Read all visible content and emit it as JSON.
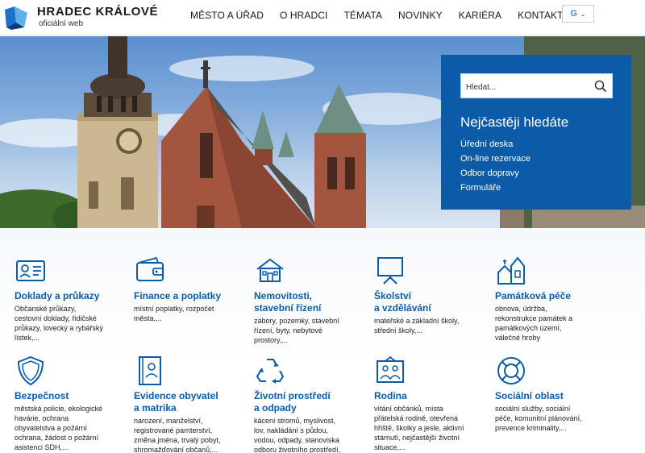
{
  "header": {
    "logo_title": "HRADEC KRÁLOVÉ",
    "logo_subtitle": "oficiální web",
    "nav": [
      "MĚSTO A ÚŘAD",
      "O HRADCI",
      "TÉMATA",
      "NOVINKY",
      "KARIÉRA",
      "KONTAKTY"
    ],
    "language_icon": "google-translate-icon"
  },
  "search": {
    "placeholder": "Hledat...",
    "heading": "Nejčastěji hledáte",
    "links": [
      "Úřední deska",
      "On-line rezervace",
      "Odbor dopravy",
      "Formuláře"
    ]
  },
  "tiles": [
    {
      "icon": "id-card-icon",
      "title_lines": [
        "Doklady a průkazy"
      ],
      "desc_lines": [
        "Občanské průkazy,",
        "cestovní doklady, řidičské",
        "průkazy, lovecký a rybářský",
        "lístek,..."
      ]
    },
    {
      "icon": "wallet-icon",
      "title_lines": [
        "Finance a poplatky"
      ],
      "desc_lines": [
        "místní poplatky, rozpočet",
        "města,..."
      ]
    },
    {
      "icon": "house-icon",
      "title_lines": [
        "Nemovitosti,",
        "stavební řízení"
      ],
      "desc_lines": [
        "zábory, pozemky, stavební",
        "řízení, byty, nebytové",
        "prostory,..."
      ]
    },
    {
      "icon": "chalkboard-icon",
      "title_lines": [
        "Školství",
        "a vzdělávání"
      ],
      "desc_lines": [
        "mateřské a základní školy,",
        "střední školy,..."
      ]
    },
    {
      "icon": "monument-icon",
      "title_lines": [
        "Památková péče"
      ],
      "desc_lines": [
        "obnova, údržba,",
        "rekonstrukce památek a",
        "památkových území,",
        "válečné hroby"
      ]
    },
    {
      "icon": "shield-icon",
      "title_lines": [
        "Bezpečnost"
      ],
      "desc_lines": [
        "městská policie, ekologické",
        "havárie, ochrana",
        "obyvatelstva a požární",
        "ochrana, žádost o požární",
        "asistenci SDH,..."
      ]
    },
    {
      "icon": "registry-book-icon",
      "title_lines": [
        "Evidence obyvatel",
        "a matrika"
      ],
      "desc_lines": [
        "narození, manželství,",
        "registrované parnterství,",
        "změna jména, trvalý pobyt,",
        "shromažďování občanů,..."
      ]
    },
    {
      "icon": "recycle-icon",
      "title_lines": [
        "Životní prostředí",
        "a odpady"
      ],
      "desc_lines": [
        "kácení stromů, myslivost,",
        "lov, nakládání s půdou,",
        "vodou, odpady, stanoviska",
        "odboru životního prostředí,"
      ]
    },
    {
      "icon": "family-icon",
      "title_lines": [
        "Rodina"
      ],
      "desc_lines": [
        "vítání občánků, místa",
        "přátelská rodině, otevřená",
        "hřiště, školky a jesle, aktivní",
        "stárnutí, nejčastější životní",
        "situace,..."
      ]
    },
    {
      "icon": "lifebuoy-icon",
      "title_lines": [
        "Sociální oblast"
      ],
      "desc_lines": [
        "sociální služby, sociální",
        "péče, komunitní plánování,",
        "prevence kriminality,..."
      ]
    }
  ],
  "colors": {
    "brand_blue": "#0b5ba8",
    "panel_blue": "#0b5ba8",
    "text": "#1a1a1a"
  }
}
